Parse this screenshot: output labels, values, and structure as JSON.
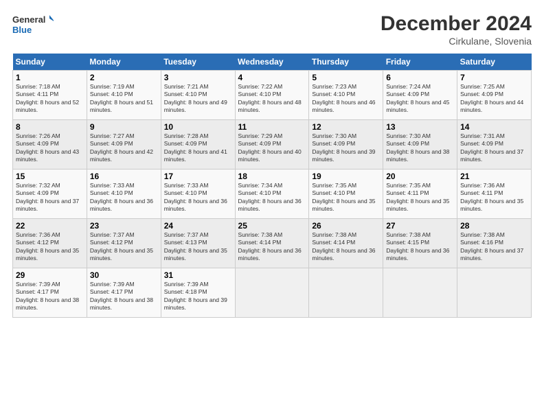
{
  "header": {
    "logo_line1": "General",
    "logo_line2": "Blue",
    "title": "December 2024",
    "subtitle": "Cirkulane, Slovenia"
  },
  "days_of_week": [
    "Sunday",
    "Monday",
    "Tuesday",
    "Wednesday",
    "Thursday",
    "Friday",
    "Saturday"
  ],
  "weeks": [
    [
      {
        "day": "1",
        "sunrise": "7:18 AM",
        "sunset": "4:11 PM",
        "daylight": "8 hours and 52 minutes."
      },
      {
        "day": "2",
        "sunrise": "7:19 AM",
        "sunset": "4:10 PM",
        "daylight": "8 hours and 51 minutes."
      },
      {
        "day": "3",
        "sunrise": "7:21 AM",
        "sunset": "4:10 PM",
        "daylight": "8 hours and 49 minutes."
      },
      {
        "day": "4",
        "sunrise": "7:22 AM",
        "sunset": "4:10 PM",
        "daylight": "8 hours and 48 minutes."
      },
      {
        "day": "5",
        "sunrise": "7:23 AM",
        "sunset": "4:10 PM",
        "daylight": "8 hours and 46 minutes."
      },
      {
        "day": "6",
        "sunrise": "7:24 AM",
        "sunset": "4:09 PM",
        "daylight": "8 hours and 45 minutes."
      },
      {
        "day": "7",
        "sunrise": "7:25 AM",
        "sunset": "4:09 PM",
        "daylight": "8 hours and 44 minutes."
      }
    ],
    [
      {
        "day": "8",
        "sunrise": "7:26 AM",
        "sunset": "4:09 PM",
        "daylight": "8 hours and 43 minutes."
      },
      {
        "day": "9",
        "sunrise": "7:27 AM",
        "sunset": "4:09 PM",
        "daylight": "8 hours and 42 minutes."
      },
      {
        "day": "10",
        "sunrise": "7:28 AM",
        "sunset": "4:09 PM",
        "daylight": "8 hours and 41 minutes."
      },
      {
        "day": "11",
        "sunrise": "7:29 AM",
        "sunset": "4:09 PM",
        "daylight": "8 hours and 40 minutes."
      },
      {
        "day": "12",
        "sunrise": "7:30 AM",
        "sunset": "4:09 PM",
        "daylight": "8 hours and 39 minutes."
      },
      {
        "day": "13",
        "sunrise": "7:30 AM",
        "sunset": "4:09 PM",
        "daylight": "8 hours and 38 minutes."
      },
      {
        "day": "14",
        "sunrise": "7:31 AM",
        "sunset": "4:09 PM",
        "daylight": "8 hours and 37 minutes."
      }
    ],
    [
      {
        "day": "15",
        "sunrise": "7:32 AM",
        "sunset": "4:09 PM",
        "daylight": "8 hours and 37 minutes."
      },
      {
        "day": "16",
        "sunrise": "7:33 AM",
        "sunset": "4:10 PM",
        "daylight": "8 hours and 36 minutes."
      },
      {
        "day": "17",
        "sunrise": "7:33 AM",
        "sunset": "4:10 PM",
        "daylight": "8 hours and 36 minutes."
      },
      {
        "day": "18",
        "sunrise": "7:34 AM",
        "sunset": "4:10 PM",
        "daylight": "8 hours and 36 minutes."
      },
      {
        "day": "19",
        "sunrise": "7:35 AM",
        "sunset": "4:10 PM",
        "daylight": "8 hours and 35 minutes."
      },
      {
        "day": "20",
        "sunrise": "7:35 AM",
        "sunset": "4:11 PM",
        "daylight": "8 hours and 35 minutes."
      },
      {
        "day": "21",
        "sunrise": "7:36 AM",
        "sunset": "4:11 PM",
        "daylight": "8 hours and 35 minutes."
      }
    ],
    [
      {
        "day": "22",
        "sunrise": "7:36 AM",
        "sunset": "4:12 PM",
        "daylight": "8 hours and 35 minutes."
      },
      {
        "day": "23",
        "sunrise": "7:37 AM",
        "sunset": "4:12 PM",
        "daylight": "8 hours and 35 minutes."
      },
      {
        "day": "24",
        "sunrise": "7:37 AM",
        "sunset": "4:13 PM",
        "daylight": "8 hours and 35 minutes."
      },
      {
        "day": "25",
        "sunrise": "7:38 AM",
        "sunset": "4:14 PM",
        "daylight": "8 hours and 36 minutes."
      },
      {
        "day": "26",
        "sunrise": "7:38 AM",
        "sunset": "4:14 PM",
        "daylight": "8 hours and 36 minutes."
      },
      {
        "day": "27",
        "sunrise": "7:38 AM",
        "sunset": "4:15 PM",
        "daylight": "8 hours and 36 minutes."
      },
      {
        "day": "28",
        "sunrise": "7:38 AM",
        "sunset": "4:16 PM",
        "daylight": "8 hours and 37 minutes."
      }
    ],
    [
      {
        "day": "29",
        "sunrise": "7:39 AM",
        "sunset": "4:17 PM",
        "daylight": "8 hours and 38 minutes."
      },
      {
        "day": "30",
        "sunrise": "7:39 AM",
        "sunset": "4:17 PM",
        "daylight": "8 hours and 38 minutes."
      },
      {
        "day": "31",
        "sunrise": "7:39 AM",
        "sunset": "4:18 PM",
        "daylight": "8 hours and 39 minutes."
      },
      null,
      null,
      null,
      null
    ]
  ]
}
